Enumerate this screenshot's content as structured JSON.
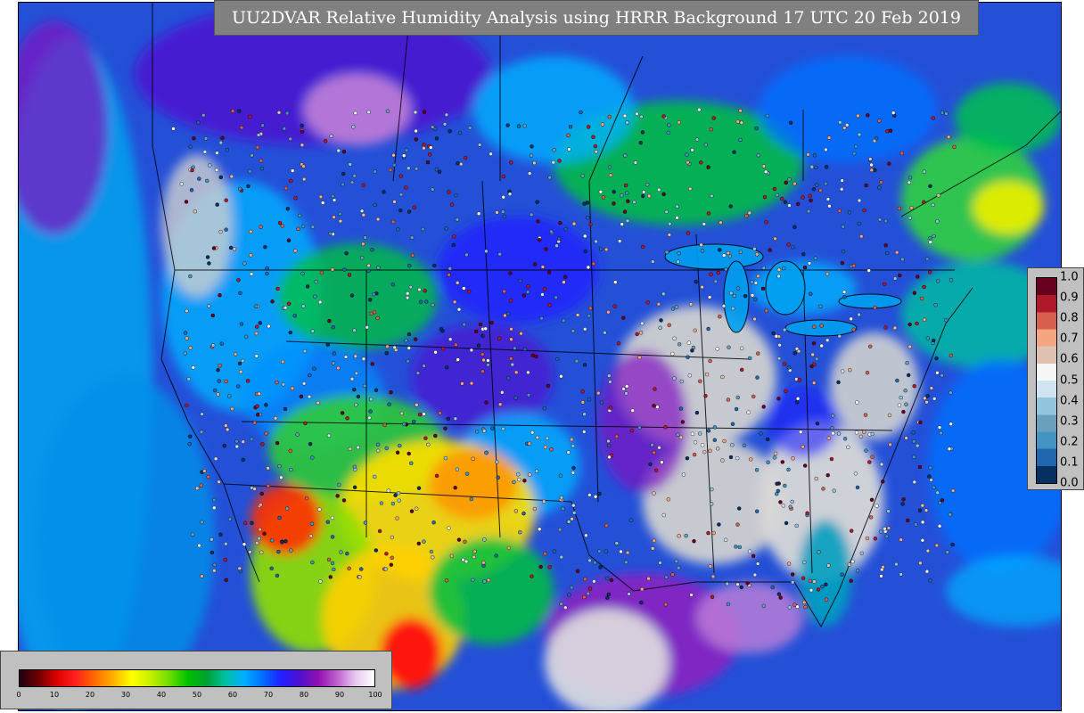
{
  "title": "UU2DVAR Relative Humidity Analysis using HRRR Background 17 UTC 20 Feb 2019",
  "rh_colorbar": {
    "ticks": [
      "0",
      "10",
      "20",
      "30",
      "40",
      "50",
      "60",
      "70",
      "80",
      "90",
      "100"
    ],
    "colors": [
      "#200010",
      "#6b0000",
      "#e00000",
      "#ff2020",
      "#ff6a00",
      "#ffb000",
      "#ffff00",
      "#c8f000",
      "#70dd00",
      "#00c000",
      "#00a030",
      "#00c0a0",
      "#00b0ff",
      "#0070ff",
      "#2020ff",
      "#5010d0",
      "#9010b0",
      "#c060d0",
      "#e8c8f0",
      "#ffffff"
    ]
  },
  "ratio_colorbar": {
    "ticks": [
      "1.0",
      "0.9",
      "0.8",
      "0.7",
      "0.6",
      "0.5",
      "0.4",
      "0.3",
      "0.2",
      "0.1",
      "0.0"
    ],
    "colors": [
      "#67001f",
      "#b2182b",
      "#d6604d",
      "#f4a582",
      "#e0c0b0",
      "#f7f7f7",
      "#d1e5f0",
      "#92c5de",
      "#6a9fbd",
      "#4393c3",
      "#2166ac",
      "#053061"
    ]
  },
  "map_colors": {
    "ocean": "#2450d8",
    "water_cyan": "#00b0ff",
    "land_green": "#00c040",
    "dry_yellow": "#ffe000",
    "very_dry_red": "#ff1010",
    "moist_purple": "#7010c0",
    "saturated_grey": "#d0d0d0",
    "boundary": "#000000"
  }
}
